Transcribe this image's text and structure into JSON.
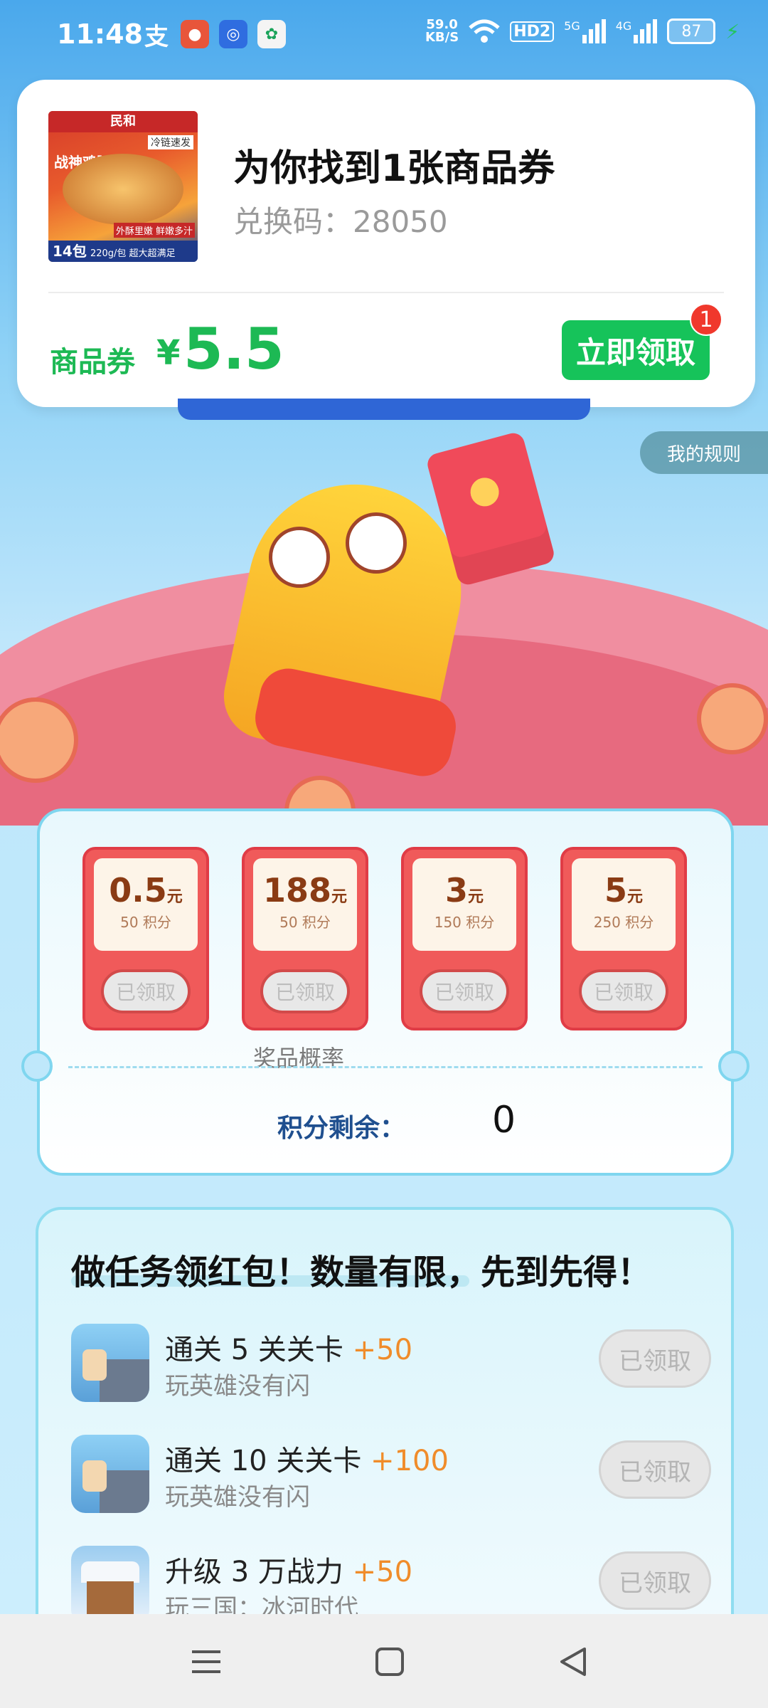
{
  "status_bar": {
    "time": "11:48",
    "speed_value": "59.0",
    "speed_unit": "KB/S",
    "hd_label": "HD2",
    "net_5g": "5G",
    "net_4g": "4G",
    "battery": "87",
    "icons": [
      "alipay-icon",
      "app-red-icon",
      "app-blue-icon",
      "app-green-icon",
      "wifi-icon",
      "signal-icon",
      "battery-icon",
      "charging-icon"
    ]
  },
  "coupon": {
    "title": "为你找到1张商品券",
    "code": "兑换码：28050",
    "label": "商品券",
    "currency": "¥",
    "amount": "5.5",
    "claim_button": "立即领取",
    "badge_count": "1",
    "product_image": {
      "brand": "民和",
      "top_note": "冷链速发",
      "name": "战神鸡腿",
      "pack": "14包",
      "footer": "220g/包 超大超满足",
      "tagline": "外酥里嫩 鲜嫩多汁"
    }
  },
  "rules_button": "我的规则",
  "prizes": [
    {
      "value": "0.5",
      "unit": "元",
      "points": "50 积分",
      "button": "已领取"
    },
    {
      "value": "188",
      "unit": "元",
      "points": "50 积分",
      "button": "已领取"
    },
    {
      "value": "3",
      "unit": "元",
      "points": "150 积分",
      "button": "已领取"
    },
    {
      "value": "5",
      "unit": "元",
      "points": "250 积分",
      "button": "已领取"
    }
  ],
  "prize_probability": "奖品概率",
  "points_remaining": {
    "label": "积分剩余：",
    "value": "0"
  },
  "tasks": {
    "title": "做任务领红包！数量有限，先到先得！",
    "items": [
      {
        "name": "通关 5 关关卡",
        "points": "+50",
        "sub": "玩英雄没有闪",
        "button": "已领取",
        "icon": "hero-game-icon"
      },
      {
        "name": "通关 10 关关卡",
        "points": "+100",
        "sub": "玩英雄没有闪",
        "button": "已领取",
        "icon": "hero-game-icon"
      },
      {
        "name": "升级 3 万战力",
        "points": "+50",
        "sub": "玩三国：冰河时代",
        "button": "已领取",
        "icon": "snow-house-icon"
      }
    ]
  },
  "nav": {
    "icons": [
      "menu-icon",
      "home-square-icon",
      "back-triangle-icon"
    ]
  },
  "colors": {
    "accent_green": "#16c35a",
    "prize_red": "#f05a5a",
    "points_orange": "#f08c2a",
    "badge_red": "#f0382c"
  }
}
